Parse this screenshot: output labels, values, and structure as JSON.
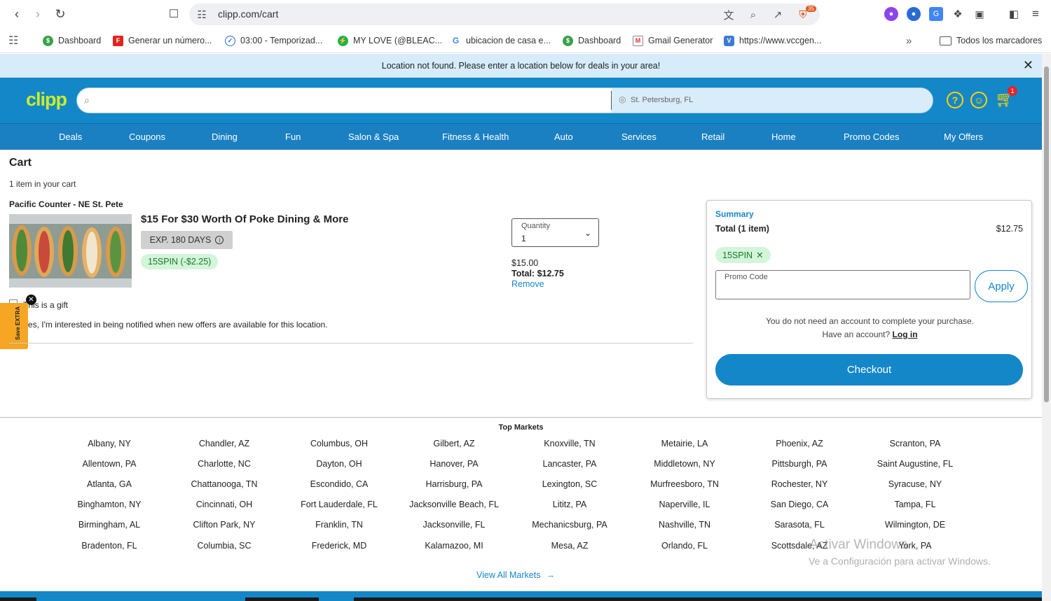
{
  "browser": {
    "url": "clipp.com/cart",
    "ext_badge": "35",
    "bookmarks": [
      {
        "label": "Dashboard",
        "icon": "cashapp-icon"
      },
      {
        "label": "Generar un número...",
        "icon": "f-icon"
      },
      {
        "label": "03:00 - Temporizad...",
        "icon": "timer-icon"
      },
      {
        "label": "MY LOVE (@BLEAC...",
        "icon": "bolt-icon"
      },
      {
        "label": "ubicacion de casa e...",
        "icon": "google-icon"
      },
      {
        "label": "Dashboard",
        "icon": "cashapp-icon"
      },
      {
        "label": "Gmail Generator",
        "icon": "gmail-icon"
      },
      {
        "label": "https://www.vccgen...",
        "icon": "v-icon"
      }
    ],
    "all_bookmarks": "Todos los marcadores"
  },
  "notice": {
    "text": "Location not found. Please enter a location below for deals in your area!"
  },
  "header": {
    "logo": "clipp",
    "search_placeholder": "",
    "location": "St. Petersburg, FL",
    "cart_count": "1"
  },
  "categories": [
    "Deals",
    "Coupons",
    "Dining",
    "Fun",
    "Salon & Spa",
    "Fitness & Health",
    "Auto",
    "Services",
    "Retail",
    "Home",
    "Promo Codes",
    "My Offers"
  ],
  "cart": {
    "title": "Cart",
    "count_text": "1 item in your cart",
    "merchant": "Pacific Counter - NE St. Pete",
    "deal_title": "$15 For $30 Worth Of Poke Dining & More",
    "expiry": "EXP. 180 DAYS",
    "promo_applied": "15SPIN (-$2.25)",
    "quantity_label": "Quantity",
    "quantity": "1",
    "price": "$15.00",
    "total": "Total: $12.75",
    "remove": "Remove",
    "gift_label": "This is a gift",
    "notify_label": "Yes, I'm interested in being notified when new offers are available for this location.",
    "save_extra": "Save EXTRA"
  },
  "summary": {
    "title": "Summary",
    "total_label": "Total (1 item)",
    "total_value": "$12.75",
    "promo_chip": "15SPIN",
    "promo_placeholder": "Promo Code",
    "apply": "Apply",
    "note1": "You do not need an account to complete your purchase.",
    "note2": "Have an account?",
    "login": "Log in",
    "checkout": "Checkout"
  },
  "footer": {
    "top_markets_title": "Top Markets",
    "markets": [
      [
        "Albany, NY",
        "Allentown, PA",
        "Atlanta, GA",
        "Binghamton, NY",
        "Birmingham, AL",
        "Bradenton, FL"
      ],
      [
        "Chandler, AZ",
        "Charlotte, NC",
        "Chattanooga, TN",
        "Cincinnati, OH",
        "Clifton Park, NY",
        "Columbia, SC"
      ],
      [
        "Columbus, OH",
        "Dayton, OH",
        "Escondido, CA",
        "Fort Lauderdale, FL",
        "Franklin, TN",
        "Frederick, MD"
      ],
      [
        "Gilbert, AZ",
        "Hanover, PA",
        "Harrisburg, PA",
        "Jacksonville Beach, FL",
        "Jacksonville, FL",
        "Kalamazoo, MI"
      ],
      [
        "Knoxville, TN",
        "Lancaster, PA",
        "Lexington, SC",
        "Lititz, PA",
        "Mechanicsburg, PA",
        "Mesa, AZ"
      ],
      [
        "Metairie, LA",
        "Middletown, NY",
        "Murfreesboro, TN",
        "Naperville, IL",
        "Nashville, TN",
        "Orlando, FL"
      ],
      [
        "Phoenix, AZ",
        "Pittsburgh, PA",
        "Rochester, NY",
        "San Diego, CA",
        "Sarasota, FL",
        "Scottsdale, AZ"
      ],
      [
        "Scranton, PA",
        "Saint Augustine, FL",
        "Syracuse, NY",
        "Tampa, FL",
        "Wilmington, DE",
        "York, PA"
      ]
    ],
    "view_all": "View All Markets"
  },
  "watermark": {
    "line1": "Activar Windows",
    "line2": "Ve a Configuración para activar Windows."
  },
  "colors": {
    "brand_blue": "#1487c9",
    "logo_green": "#c9ed2a",
    "accent_yellow": "#ffd400",
    "promo_green_bg": "#d3f5d9"
  }
}
